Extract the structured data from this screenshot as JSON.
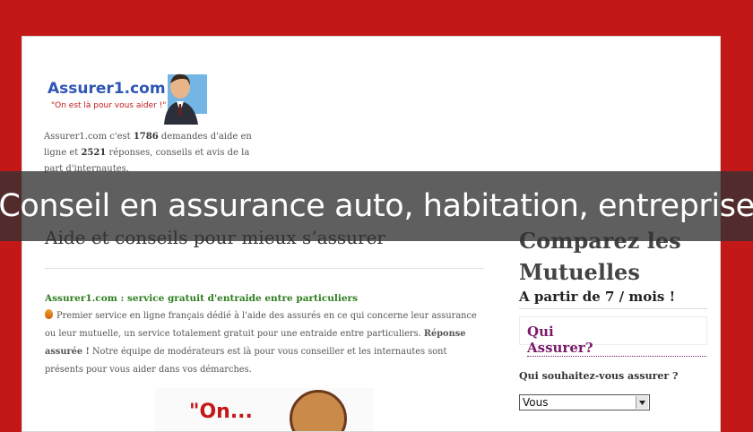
{
  "logo": {
    "title": "Assurer1.com",
    "tagline": "\"On est là pour vous aider !\""
  },
  "intro": {
    "site": "Assurer1.com",
    "text1": " c'est ",
    "demandes": "1786",
    "text2": " demandes d'aide en ligne et ",
    "reponses": "2521",
    "text3": " réponses, conseils et avis de la part d'internautes."
  },
  "overlay_title": "Conseil en assurance auto, habitation, entreprise",
  "main": {
    "heading": "Aide et conseils pour mieux s’assurer",
    "section_link": "Assurer1.com : service gratuit d'entraide entre particuliers",
    "paragraph_start": "Premier service en ligne français dédié à l'aide des assurés en ce qui concerne leur assurance ou leur mutuelle, un service totalement gratuit pour une entraide entre particuliers. ",
    "paragraph_bold": "Réponse assurée !",
    "paragraph_end": " Notre équipe de modérateurs est là pour vous conseiller et les internautes sont présents pour vous aider dans vos démarches.",
    "bottom_image_text": "\"On..."
  },
  "sidebar": {
    "heading": "Comparez les Mutuelles",
    "subheading": "A partir de 7 / mois !",
    "qui_link": "Qui Assurer?",
    "question": "Qui souhaitez-vous assurer ?",
    "select_value": "Vous"
  }
}
